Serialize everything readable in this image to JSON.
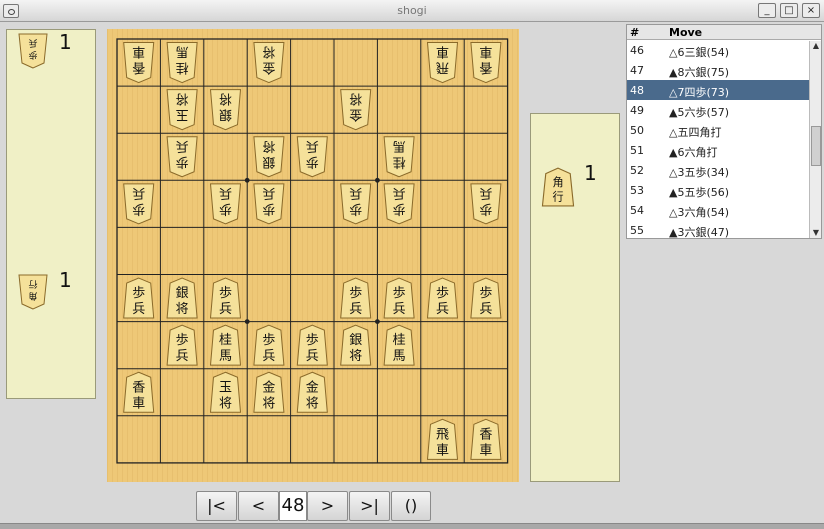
{
  "window": {
    "title": "shogi"
  },
  "colors": {
    "board": "#eec877",
    "hand_panel": "#f0f0c6",
    "selected_row": "#4a6a8c"
  },
  "top_hand": {
    "pieces": [
      {
        "kanji": "歩兵",
        "count": "1"
      },
      {
        "kanji": "角行",
        "count": "1"
      }
    ]
  },
  "bottom_hand": {
    "pieces": [
      {
        "kanji": "角行",
        "count": "1"
      }
    ]
  },
  "board": {
    "cells": [
      [
        "香車",
        "桂馬",
        "",
        "金将",
        "",
        "",
        "",
        "飛車",
        "香車"
      ],
      [
        "",
        "玉将",
        "銀将",
        "",
        "",
        "金将",
        "",
        "",
        ""
      ],
      [
        "",
        "歩兵",
        "",
        "銀将",
        "歩兵",
        "",
        "桂馬",
        "",
        ""
      ],
      [
        "歩兵",
        "",
        "歩兵",
        "歩兵",
        "",
        "歩兵",
        "歩兵",
        "",
        "歩兵"
      ],
      [
        "",
        "",
        "",
        "",
        "",
        "",
        "",
        "",
        ""
      ],
      [
        "歩兵",
        "銀将",
        "歩兵",
        "",
        "",
        "歩兵",
        "歩兵",
        "歩兵",
        "歩兵"
      ],
      [
        "",
        "歩兵",
        "桂馬",
        "歩兵",
        "歩兵",
        "銀将",
        "桂馬",
        "",
        ""
      ],
      [
        "香車",
        "",
        "玉将",
        "金将",
        "金将",
        "",
        "",
        "",
        ""
      ],
      [
        "",
        "",
        "",
        "",
        "",
        "",
        "",
        "飛車",
        "香車"
      ]
    ],
    "owners": [
      [
        "g",
        "g",
        "",
        "g",
        "",
        "",
        "",
        "g",
        "g"
      ],
      [
        "",
        "g",
        "g",
        "",
        "",
        "g",
        "",
        "",
        ""
      ],
      [
        "",
        "g",
        "",
        "g",
        "g",
        "",
        "g",
        "",
        ""
      ],
      [
        "g",
        "",
        "g",
        "g",
        "",
        "g",
        "g",
        "",
        "g"
      ],
      [
        "",
        "",
        "",
        "",
        "",
        "",
        "",
        "",
        ""
      ],
      [
        "s",
        "s",
        "s",
        "",
        "",
        "s",
        "s",
        "s",
        "s"
      ],
      [
        "",
        "s",
        "s",
        "s",
        "s",
        "s",
        "s",
        "",
        ""
      ],
      [
        "s",
        "",
        "s",
        "s",
        "s",
        "",
        "",
        "",
        ""
      ],
      [
        "",
        "",
        "",
        "",
        "",
        "",
        "",
        "s",
        "s"
      ]
    ]
  },
  "movelist": {
    "headers": {
      "num": "#",
      "move": "Move"
    },
    "rows": [
      {
        "num": "46",
        "move": "△6三銀(54)"
      },
      {
        "num": "47",
        "move": "▲8六銀(75)"
      },
      {
        "num": "48",
        "move": "△7四歩(73)"
      },
      {
        "num": "49",
        "move": "▲5六歩(57)"
      },
      {
        "num": "50",
        "move": "△五四角打"
      },
      {
        "num": "51",
        "move": "▲6六角打"
      },
      {
        "num": "52",
        "move": "△3五歩(34)"
      },
      {
        "num": "53",
        "move": "▲5五歩(56)"
      },
      {
        "num": "54",
        "move": "△3六角(54)"
      },
      {
        "num": "55",
        "move": "▲3六銀(47)"
      }
    ],
    "selected_index": 2
  },
  "nav": {
    "first": "|<",
    "prev": "<",
    "move_number": "48",
    "next": ">",
    "last": ">|",
    "variation": "()"
  }
}
